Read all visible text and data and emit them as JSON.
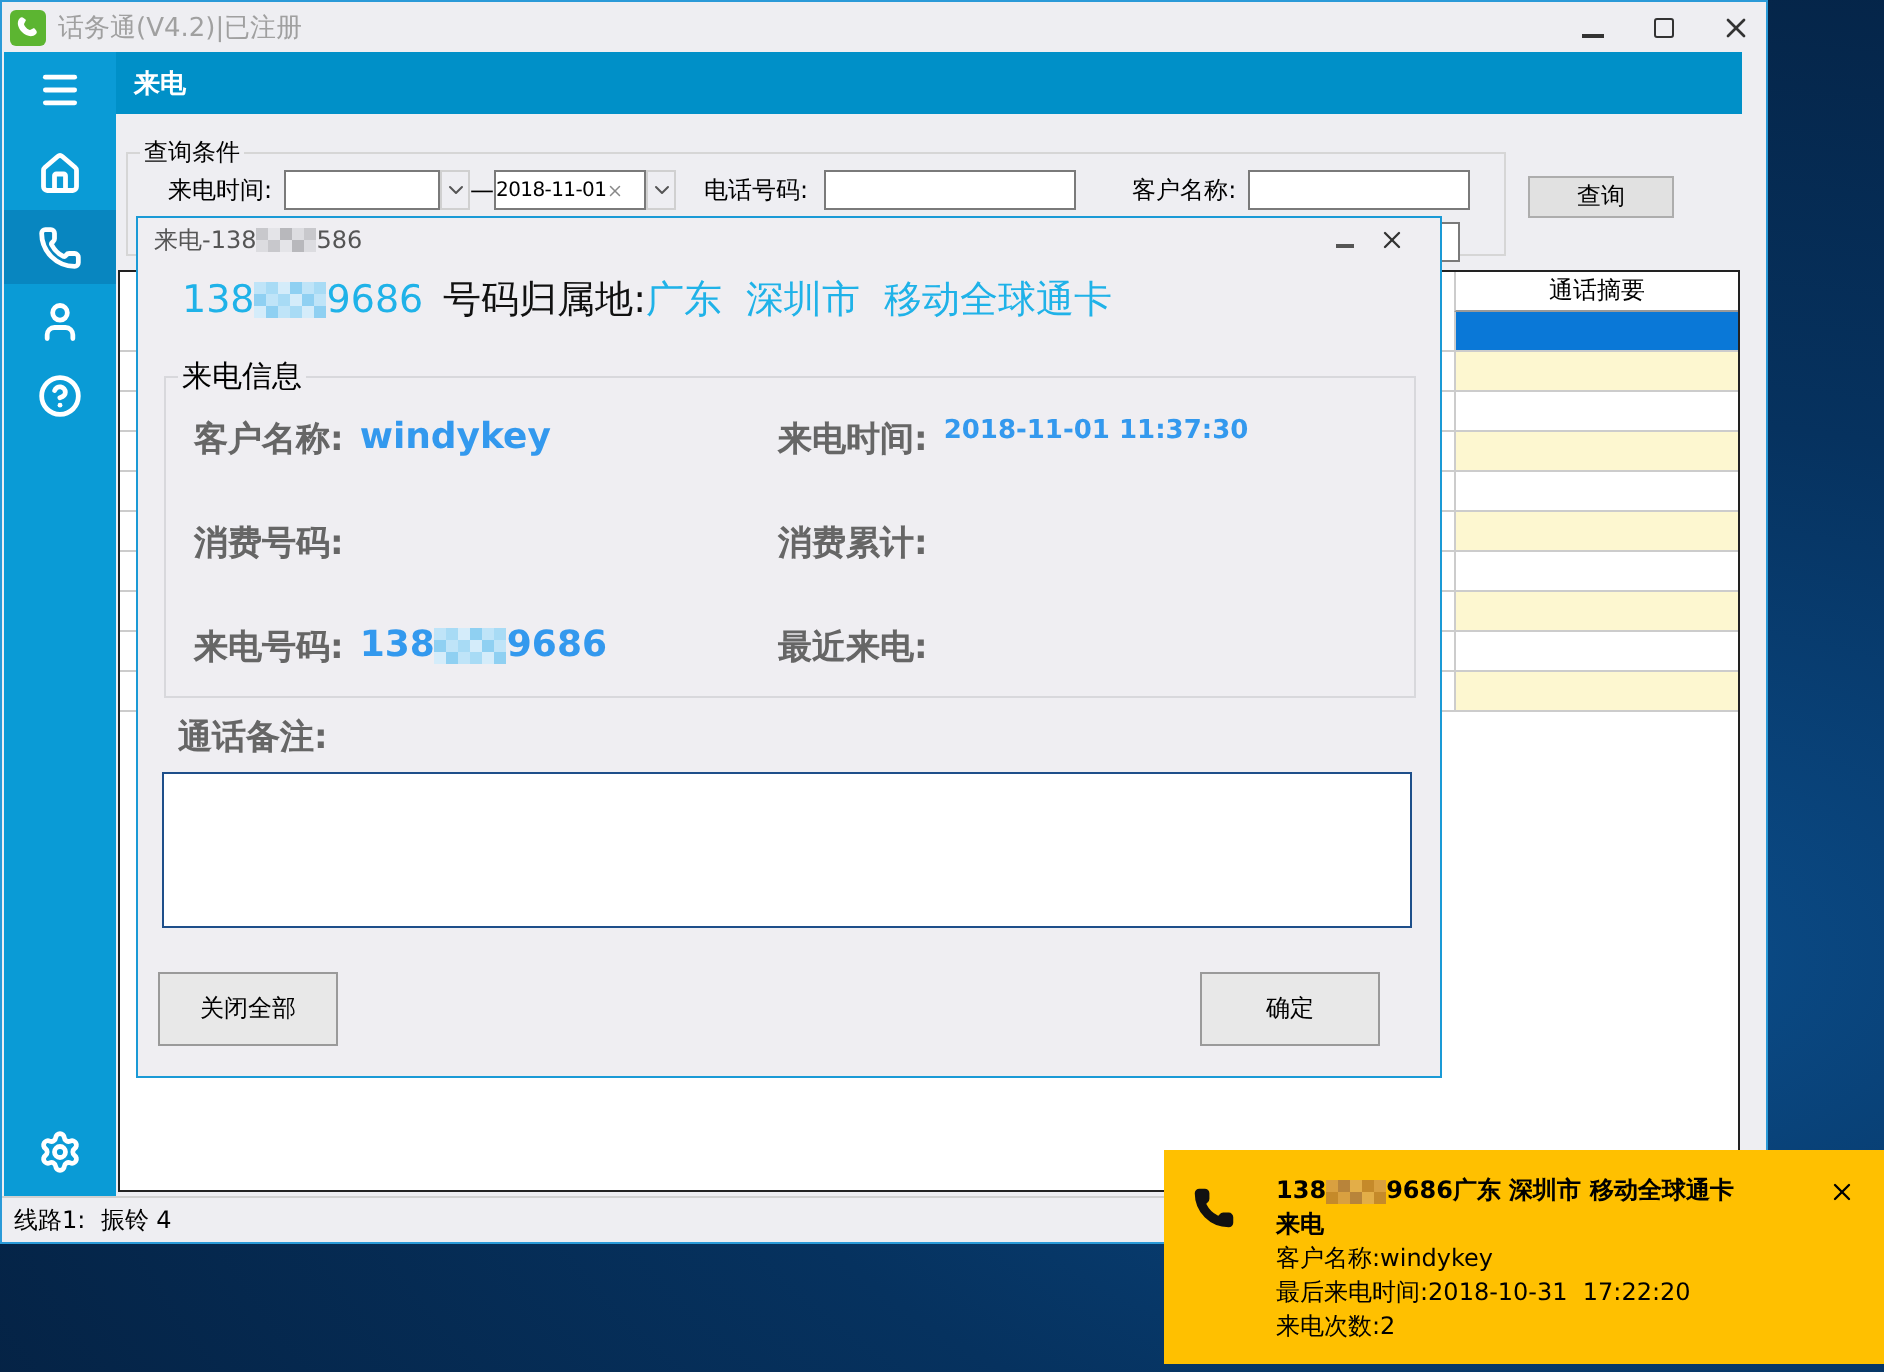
{
  "window": {
    "title": "话务通(V4.2)|已注册",
    "active": false
  },
  "sidebar": {
    "items": [
      {
        "kind": "menu",
        "selected": false
      },
      {
        "kind": "home",
        "selected": false
      },
      {
        "kind": "phone",
        "selected": true
      },
      {
        "kind": "user",
        "selected": false
      },
      {
        "kind": "help",
        "selected": false
      },
      {
        "kind": "settings",
        "selected": false
      }
    ]
  },
  "header": {
    "title": "来电"
  },
  "query": {
    "legend": "查询条件",
    "call_time_label": "来电时间:",
    "separator": "—",
    "date_to": "2018-11-01",
    "phone_label": "电话号码:",
    "customer_label": "客户名称:",
    "search_button": "查询"
  },
  "table": {
    "columns": [
      "通话摘要"
    ],
    "rows": [
      {
        "selected": true
      },
      {
        "selected": false
      },
      {
        "selected": false
      },
      {
        "selected": false
      },
      {
        "selected": false
      },
      {
        "selected": false
      },
      {
        "selected": false
      },
      {
        "selected": false
      },
      {
        "selected": false
      },
      {
        "selected": false
      }
    ]
  },
  "status_bar": "线路1:  振铃 4",
  "dialog": {
    "title_prefix": "来电-138",
    "title_suffix": "586",
    "number_prefix": "138",
    "number_suffix": "9686",
    "location_label": "号码归属地:",
    "location": [
      "广东",
      "深圳市",
      "移动全球通卡"
    ],
    "section": "来电信息",
    "fields": [
      {
        "label": "客户名称:",
        "kind": "text",
        "value": "windykey"
      },
      {
        "label": "来电时间:",
        "kind": "time",
        "value": "2018-11-01 11:37:30"
      },
      {
        "label": "消费号码:",
        "kind": "empty"
      },
      {
        "label": "消费累计:",
        "kind": "empty"
      },
      {
        "label": "来电号码:",
        "kind": "masked",
        "prefix": "138",
        "suffix": "9686"
      },
      {
        "label": "最近来电:",
        "kind": "empty"
      }
    ],
    "remarks_label": "通话备注:",
    "buttons": [
      "关闭全部",
      "确定"
    ]
  },
  "toast": {
    "number_prefix": "138",
    "headline_rest": "9686广东 深圳市 移动全球通卡",
    "subtitle": "来电",
    "lines": [
      "客户名称:windykey",
      "最后来电时间:2018-10-31  17:22:20",
      "来电次数:2"
    ]
  }
}
